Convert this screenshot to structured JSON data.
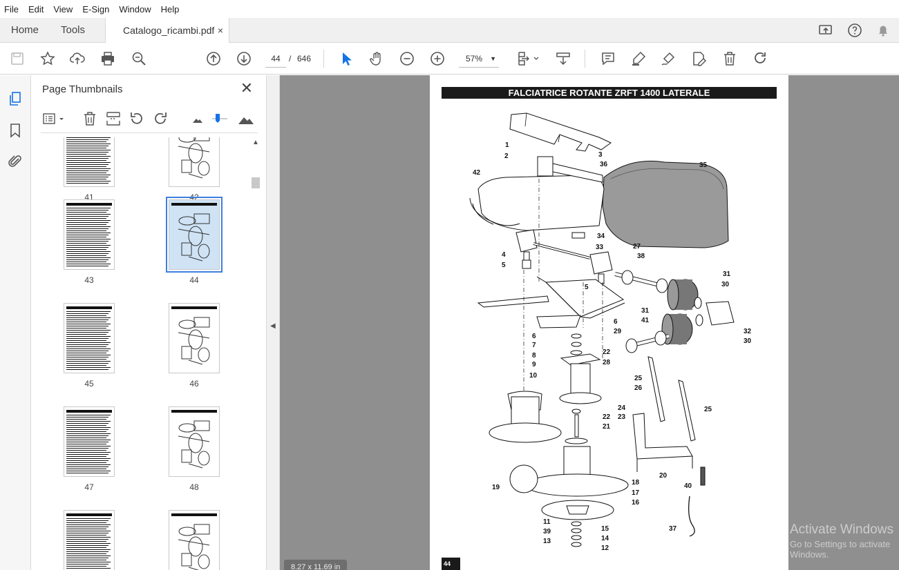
{
  "menu": [
    "File",
    "Edit",
    "View",
    "E-Sign",
    "Window",
    "Help"
  ],
  "tabs": {
    "home": "Home",
    "tools": "Tools",
    "document": "Catalogo_ricambi.pdf",
    "close_symbol": "×"
  },
  "toolbar": {
    "page_current": "44",
    "page_separator": "/",
    "page_total": "646",
    "zoom": "57%",
    "icons": [
      "save-icon",
      "star-icon",
      "upload-icon",
      "print-icon",
      "zoom-search-icon",
      "page-up-icon",
      "page-down-icon",
      "select-arrow-icon",
      "hand-icon",
      "zoom-out-icon",
      "zoom-in-icon",
      "fit-page-icon",
      "scroll-mode-icon",
      "comment-icon",
      "highlight-icon",
      "sign-icon",
      "edit-icon",
      "delete-icon",
      "redo-icon"
    ]
  },
  "panel": {
    "title": "Page Thumbnails",
    "close_symbol": "✕",
    "thumbnails": [
      {
        "label": "41",
        "kind": "list"
      },
      {
        "label": "42",
        "kind": "diagram"
      },
      {
        "label": "43",
        "kind": "list"
      },
      {
        "label": "44",
        "kind": "diagram",
        "selected": true
      },
      {
        "label": "45",
        "kind": "list"
      },
      {
        "label": "46",
        "kind": "diagram"
      },
      {
        "label": "47",
        "kind": "list"
      },
      {
        "label": "48",
        "kind": "diagram"
      },
      {
        "label": "",
        "kind": "list"
      },
      {
        "label": "",
        "kind": "diagram"
      }
    ]
  },
  "document": {
    "title": "FALCIATRICE ROTANTE ZRFT 1400 LATERALE",
    "page_number": "44",
    "page_size": "8.27 x 11.69 in",
    "part_labels": [
      "1",
      "2",
      "3",
      "36",
      "42",
      "35",
      "34",
      "33",
      "27",
      "4",
      "5",
      "38",
      "31",
      "30",
      "5",
      "6",
      "29",
      "31",
      "41",
      "32",
      "30",
      "6",
      "7",
      "8",
      "9",
      "22",
      "28",
      "10",
      "25",
      "26",
      "25",
      "24",
      "23",
      "22",
      "21",
      "20",
      "40",
      "18",
      "19",
      "17",
      "16",
      "11",
      "15",
      "39",
      "14",
      "13",
      "12",
      "37"
    ]
  },
  "watermark": {
    "line1": "Activate Windows",
    "line2": "Go to Settings to activate Windows."
  }
}
